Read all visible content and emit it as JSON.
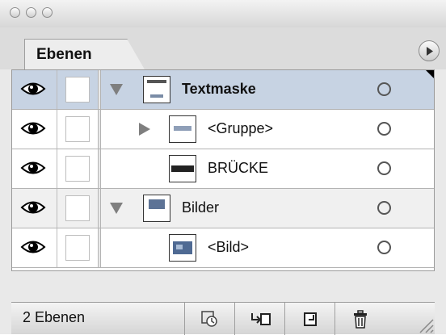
{
  "window": {
    "traffic_lights": [
      "close-light",
      "minimize-light",
      "zoom-light"
    ]
  },
  "tab": {
    "label": "Ebenen"
  },
  "layers": [
    {
      "name": "Textmaske",
      "type": "group",
      "expanded": true,
      "selected": true
    },
    {
      "name": "<Gruppe>",
      "type": "group",
      "expanded": false,
      "selected": false
    },
    {
      "name": "BRÜCKE",
      "type": "layer",
      "selected": false
    },
    {
      "name": "Bilder",
      "type": "group",
      "expanded": true,
      "selected": false
    },
    {
      "name": "<Bild>",
      "type": "layer",
      "selected": false
    }
  ],
  "status": {
    "text": "2 Ebenen"
  },
  "icons": {
    "visibility": "eye-icon",
    "expand": "triangle-down-icon",
    "collapse": "triangle-right-icon",
    "target": "target-circle-icon",
    "panel_menu": "panel-menu-icon",
    "new_set": "new-layer-set-icon",
    "move_to": "move-to-layer-icon",
    "new_layer": "new-layer-icon",
    "delete": "trash-icon"
  },
  "colors": {
    "selected_row": "#c7d3e3",
    "group_row": "#f0f0f0"
  }
}
